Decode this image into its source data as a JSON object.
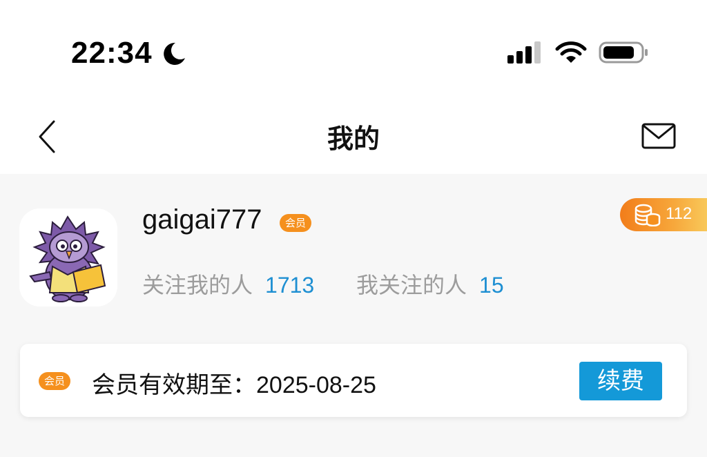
{
  "status_bar": {
    "time": "22:34"
  },
  "header": {
    "title": "我的",
    "icons": [
      "back-icon",
      "mail-icon"
    ]
  },
  "profile": {
    "username": "gaigai777",
    "member_badge": "会员",
    "coins": "112",
    "followers_label": "关注我的人",
    "followers_count": "1713",
    "following_label": "我关注的人",
    "following_count": "15"
  },
  "membership": {
    "badge": "会员",
    "expiry_label": "会员有效期至：",
    "expiry_date": "2025-08-25",
    "renew_label": "续费"
  },
  "colors": {
    "accent_blue": "#1499d8",
    "link_blue": "#1e8fd2",
    "badge_orange": "#f5901e"
  }
}
